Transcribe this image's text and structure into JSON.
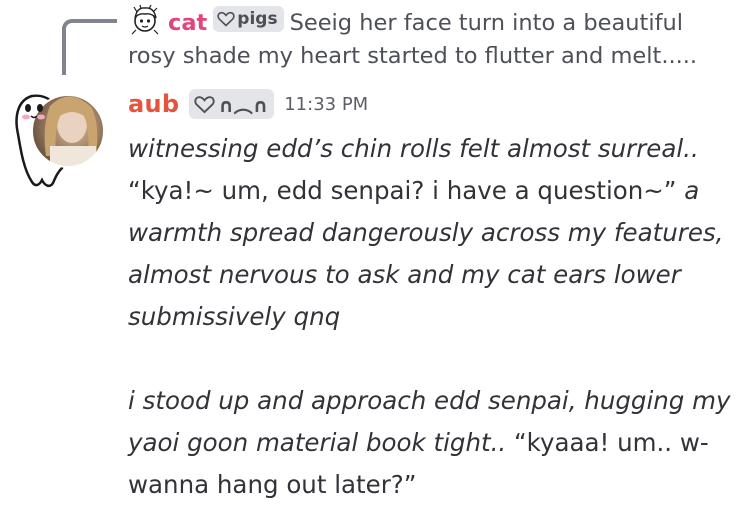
{
  "reply": {
    "author": "cat",
    "tag_text": "pigs",
    "avatar_icon": "doodle-avatar-icon",
    "preview_text": "Seeig her face turn into a beautiful rosy shade my heart started to flutter and melt....."
  },
  "message": {
    "author": "aub",
    "author_color": "#e8533c",
    "tag_text": "∩︵∩",
    "timestamp": "11:33 PM",
    "paragraph1": {
      "italic_a": "witnessing edd’s chin rolls felt almost surreal.. ",
      "plain": "“kya!~ um, edd senpai? i have a question~” ",
      "italic_b": "a warmth spread dangerously across my features, almost nervous to ask and my cat ears lower submissively qnq"
    },
    "paragraph2": {
      "italic": "i stood up and approach edd senpai, hugging my yaoi goon material book tight.. ",
      "plain": "“kyaaa! um.. w-wanna hang out later?”"
    }
  }
}
